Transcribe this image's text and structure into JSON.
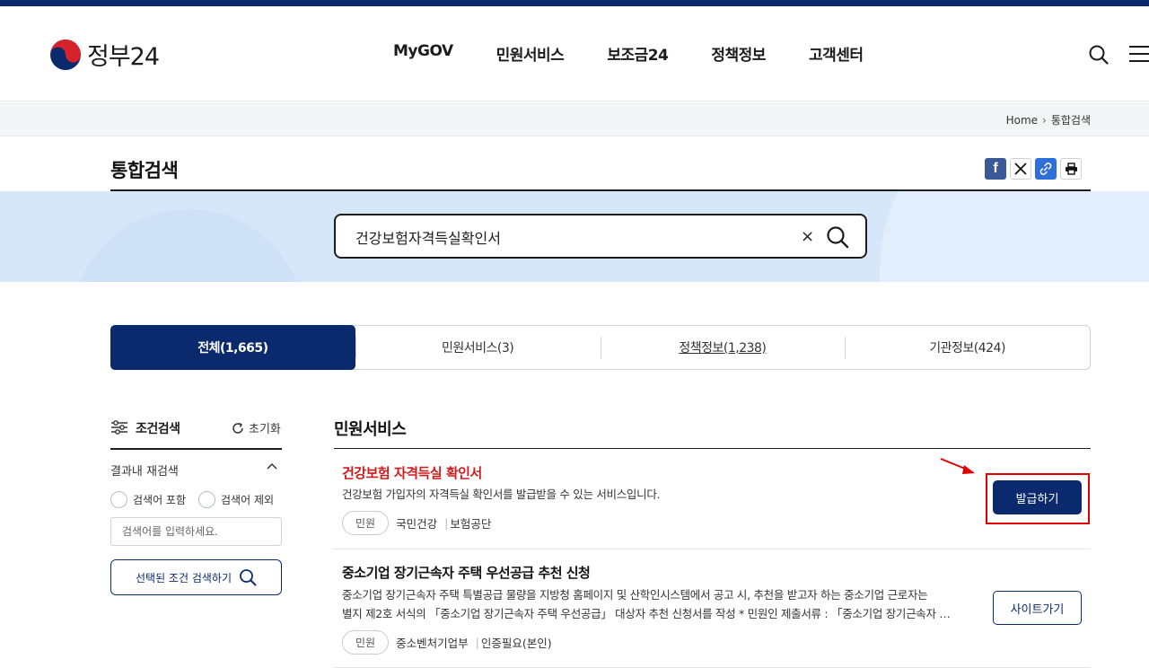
{
  "header": {
    "logo_text": "정부24",
    "nav": [
      "MyGOV",
      "민원서비스",
      "보조금24",
      "정책정보",
      "고객센터"
    ]
  },
  "breadcrumb": {
    "home": "Home",
    "current": "통합검색"
  },
  "page": {
    "title": "통합검색"
  },
  "share": {
    "icons": [
      "facebook-icon",
      "x-icon",
      "link-icon",
      "print-icon"
    ],
    "facebook_label": "f"
  },
  "search": {
    "value": "건강보험자격득실확인서",
    "clear_label": "×"
  },
  "tabs": [
    {
      "label": "전체(1,665)",
      "active": true
    },
    {
      "label": "민원서비스(3)",
      "active": false
    },
    {
      "label": "정책정보(1,238)",
      "active": false
    },
    {
      "label": "기관정보(424)",
      "active": false
    }
  ],
  "filter": {
    "title": "조건검색",
    "reset_label": "초기화",
    "refine_label": "결과내 재검색",
    "include_label": "검색어 포함",
    "exclude_label": "검색어 제외",
    "keyword_placeholder": "검색어를 입력하세요.",
    "submit_label": "선택된 조건 검색하기"
  },
  "results": {
    "section_title": "민원서비스",
    "items": [
      {
        "title": "건강보험 자격득실 확인서",
        "description": "건강보험 가입자의 자격득실 확인서를 발급받을 수 있는 서비스입니다.",
        "tag": "민원",
        "meta1": "국민건강",
        "meta2": "보험공단",
        "button": "발급하기"
      },
      {
        "title": "중소기업 장기근속자 주택 우선공급 추천 신청",
        "description_line1": "중소기업 장기근속자 주택 특별공급 물량을 지방청 홈페이지 및 산학인시스템에서 공고 시, 추천을 받고자 하는 중소기업 근로자는",
        "description_line2": "별지 제2호 서식의 「중소기업 장기근속자 주택 우선공급」 대상자 추천 신청서를 작성 * 민원인 제출서류 : 「중소기업 장기근속자 …",
        "tag": "민원",
        "meta1": "중소벤처기업부",
        "meta2": "인증필요(본인)",
        "button": "사이트가기"
      }
    ]
  },
  "colors": {
    "brand_navy": "#0b2a6e",
    "highlight_red": "#e00000",
    "title_red": "#d11a1a",
    "search_band": "#d6e7f9"
  }
}
